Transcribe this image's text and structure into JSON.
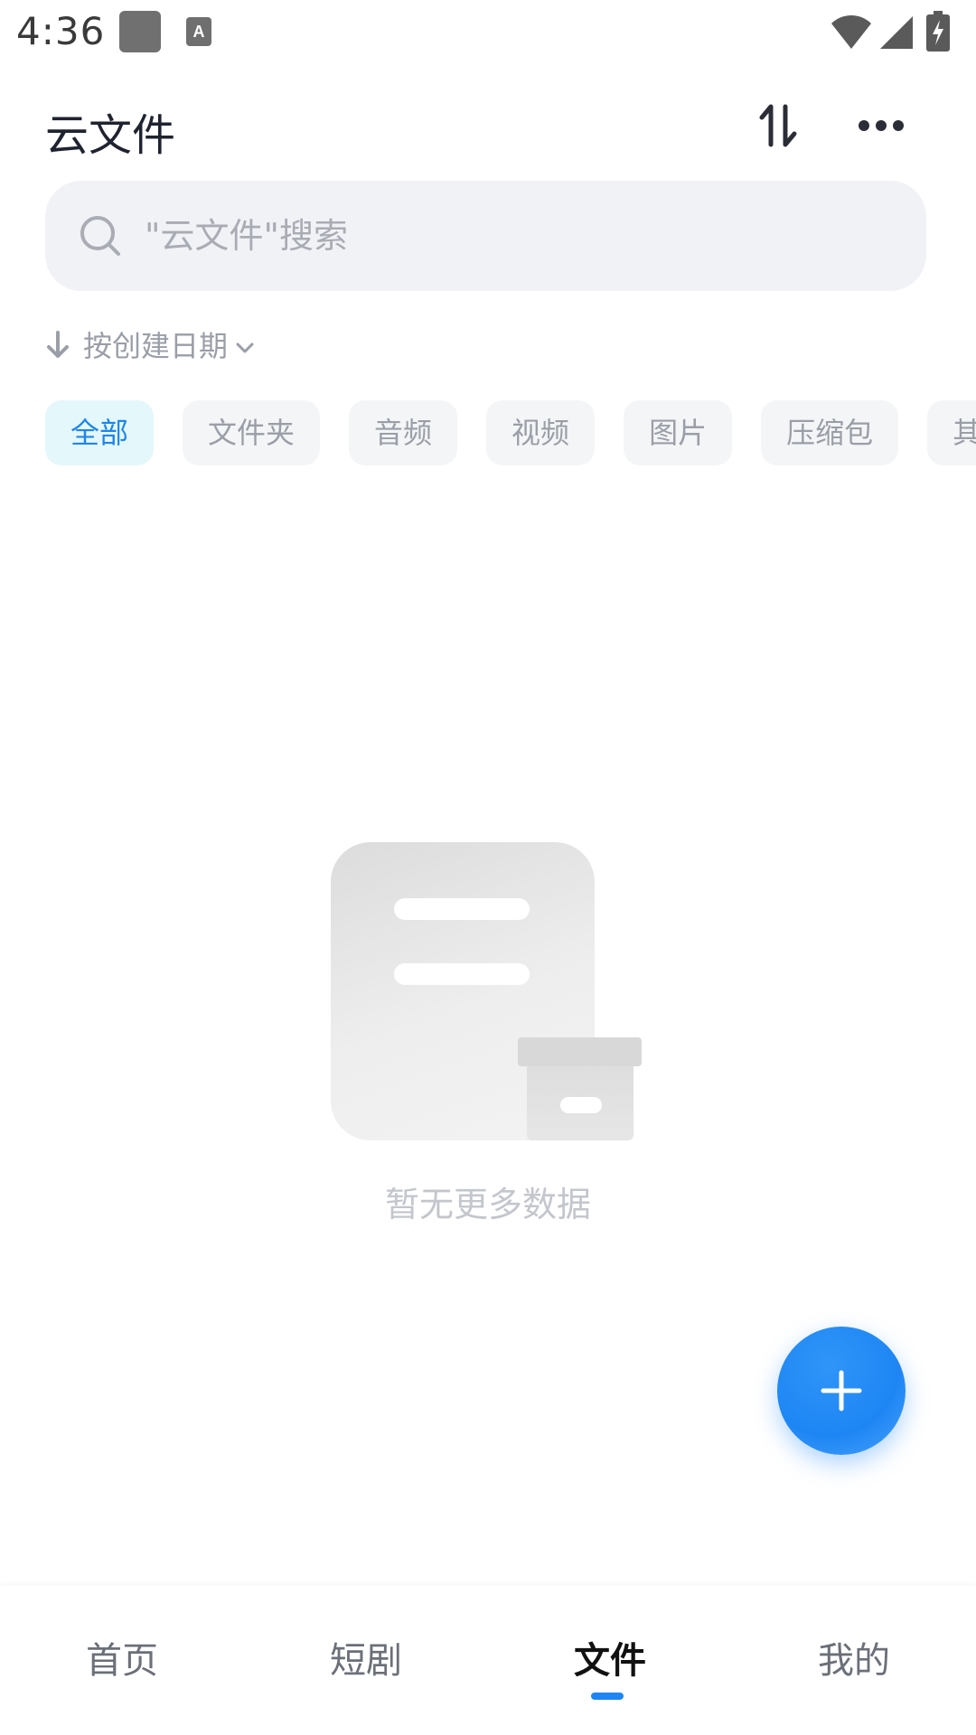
{
  "status_bar": {
    "time": "4:36",
    "icons": [
      "app-notification-icon",
      "keyboard-a-notification-icon",
      "wifi-icon",
      "signal-icon",
      "battery-charging-icon"
    ]
  },
  "header": {
    "title": "云文件",
    "sort_icon": "sort-arrows-icon",
    "more_icon": "more-dots-icon"
  },
  "search": {
    "placeholder": "\"云文件\"搜索",
    "value": ""
  },
  "sort": {
    "label": "按创建日期"
  },
  "filters": {
    "chips": [
      {
        "label": "全部",
        "active": true
      },
      {
        "label": "文件夹",
        "active": false
      },
      {
        "label": "音频",
        "active": false
      },
      {
        "label": "视频",
        "active": false
      },
      {
        "label": "图片",
        "active": false
      },
      {
        "label": "压缩包",
        "active": false
      },
      {
        "label": "其",
        "active": false
      }
    ]
  },
  "empty_state": {
    "message": "暂无更多数据"
  },
  "fab": {
    "icon": "plus-icon"
  },
  "bottom_nav": {
    "items": [
      {
        "label": "首页",
        "active": false
      },
      {
        "label": "短剧",
        "active": false
      },
      {
        "label": "文件",
        "active": true
      },
      {
        "label": "我的",
        "active": false
      }
    ]
  },
  "colors": {
    "accent": "#1e86f4",
    "chip_active_bg": "#e4f7fb",
    "search_bg": "#f1f2f6"
  }
}
